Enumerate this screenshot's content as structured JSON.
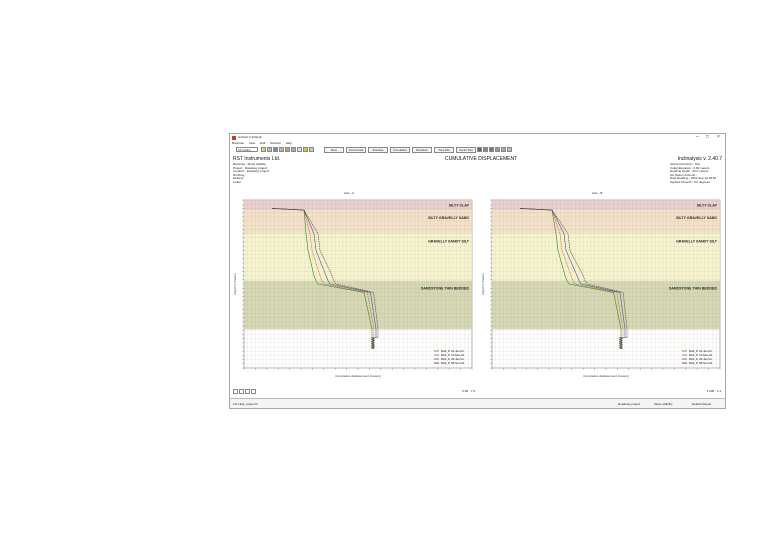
{
  "window": {
    "title": "ILChart: [Untitled]",
    "menu": [
      "Borehole",
      "View",
      "Edit",
      "Window",
      "Help"
    ],
    "search_value": "15 Inclino",
    "toolbar_buttons": [
      "Bore",
      "Incremental",
      "Absolute",
      "Cumulative",
      "Deviation",
      "Time Plot",
      "Vector Plot"
    ]
  },
  "header": {
    "company": "RST Instruments Ltd.",
    "title": "CUMULATIVE DISPLACEMENT",
    "software": "Inclinalysis v. 2.40.7",
    "left_info": [
      "Borehole : Slope stability",
      "Project : Roadway project",
      "Location : Roadway project",
      "Northing :",
      "Easting :",
      "Collar :"
    ],
    "right_info": [
      "Spiral Correction : N/A",
      "Collar Elevation : 0.00 meters",
      "Reading Depth : 29.0 meters",
      "Azi Datum Azimuth :",
      "Data Reading : 2002 Sep 10 09:52",
      "Applied Azimuth : 0.0 degrees"
    ]
  },
  "charts": [
    {
      "axis_title": "Axis - A",
      "ylabel": "Depth in meters",
      "xlabel": "Cumulative displacement (meters)",
      "layers": [
        {
          "name": "SILTY CLAY",
          "color": "#e8c8c8"
        },
        {
          "name": "SILTY GRAVELLY SAND",
          "color": "#f2dcc0"
        },
        {
          "name": "GRAVELLY SANDY SILT",
          "color": "#f5f2c8"
        },
        {
          "name": "SANDSTONE THIN BEDDED",
          "color": "#cfd1a8"
        }
      ],
      "legend": [
        "BH2_8: 10-Jan-03",
        "BH2_8: 21-Mar-03",
        "BH2_8: 25-Jan-04",
        "BH2_8: 08-Nov-04"
      ]
    },
    {
      "axis_title": "Axis - B",
      "ylabel": "Depth in meters",
      "xlabel": "Cumulative displacement (meters)",
      "layers": [
        {
          "name": "SILTY CLAY",
          "color": "#e8c8c8"
        },
        {
          "name": "SILTY GRAVELLY SAND",
          "color": "#f2dcc0"
        },
        {
          "name": "GRAVELLY SANDY SILT",
          "color": "#f5f2c8"
        },
        {
          "name": "SANDSTONE THIN BEDDED",
          "color": "#cfd1a8"
        }
      ],
      "legend": [
        "BH2_8: 10-Jan-03",
        "BH2_8: 21-Mar-03",
        "BH2_8: 25-Jan-04",
        "BH2_8: 08-Nov-04"
      ]
    }
  ],
  "series_colors": [
    "#2f8a2f",
    "#d05a1e",
    "#3a5aa8",
    "#5a3a2a"
  ],
  "bottom": {
    "coord_readout": "X:96 · Y:0",
    "zoom": "1.005 · 1.4"
  },
  "status": {
    "help": "For Help, press F1",
    "project": "Roadway project",
    "slope": "Slope stability",
    "report": "Default Report"
  }
}
